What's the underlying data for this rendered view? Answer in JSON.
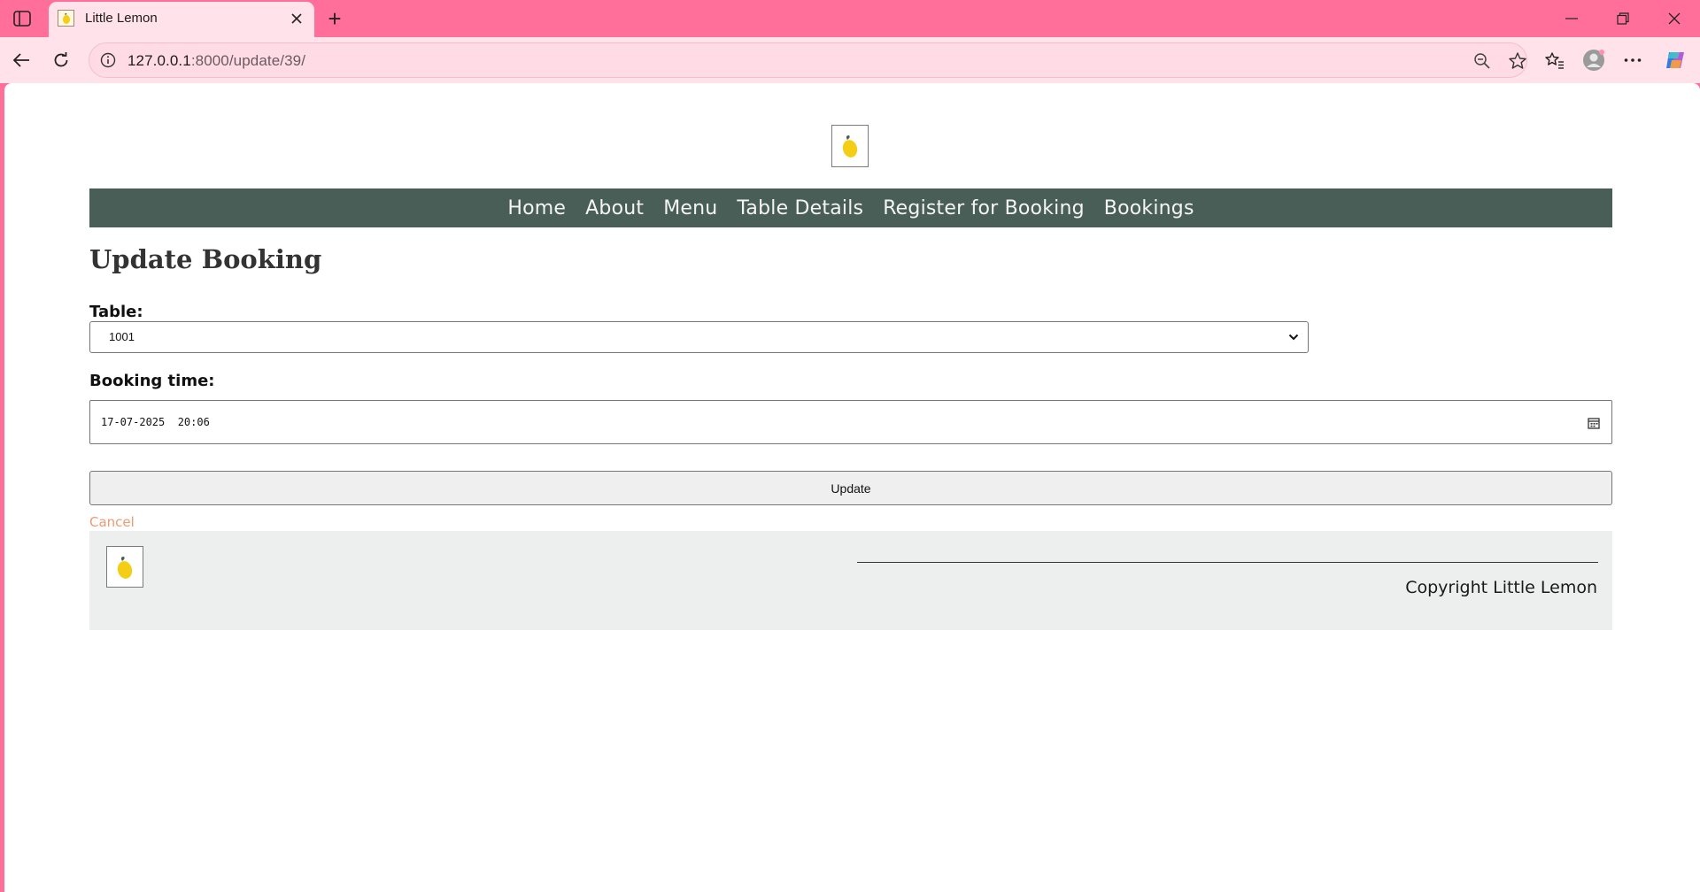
{
  "browser": {
    "tab": {
      "title": "Little Lemon",
      "favicon": "lemon-icon"
    },
    "new_tab_label": "+",
    "address": {
      "host": "127.0.0.1",
      "rest": ":8000/update/39/"
    }
  },
  "page": {
    "nav": [
      "Home",
      "About",
      "Menu",
      "Table Details",
      "Register for Booking",
      "Bookings"
    ],
    "title": "Update Booking",
    "form": {
      "table_label": "Table:",
      "table_value": "1001",
      "booking_time_label": "Booking time:",
      "booking_time_value": "17-07-2025  20:06",
      "submit_label": "Update"
    },
    "cancel_label": "Cancel",
    "footer": {
      "copyright": "Copyright Little Lemon"
    }
  },
  "colors": {
    "browser_chrome": "#ff6f9a",
    "toolbar": "#ffe2ea",
    "nav_bg": "#495e57",
    "cancel_link": "#ee9972",
    "footer_bg": "#edefee",
    "lemon": "#f4ce14"
  }
}
